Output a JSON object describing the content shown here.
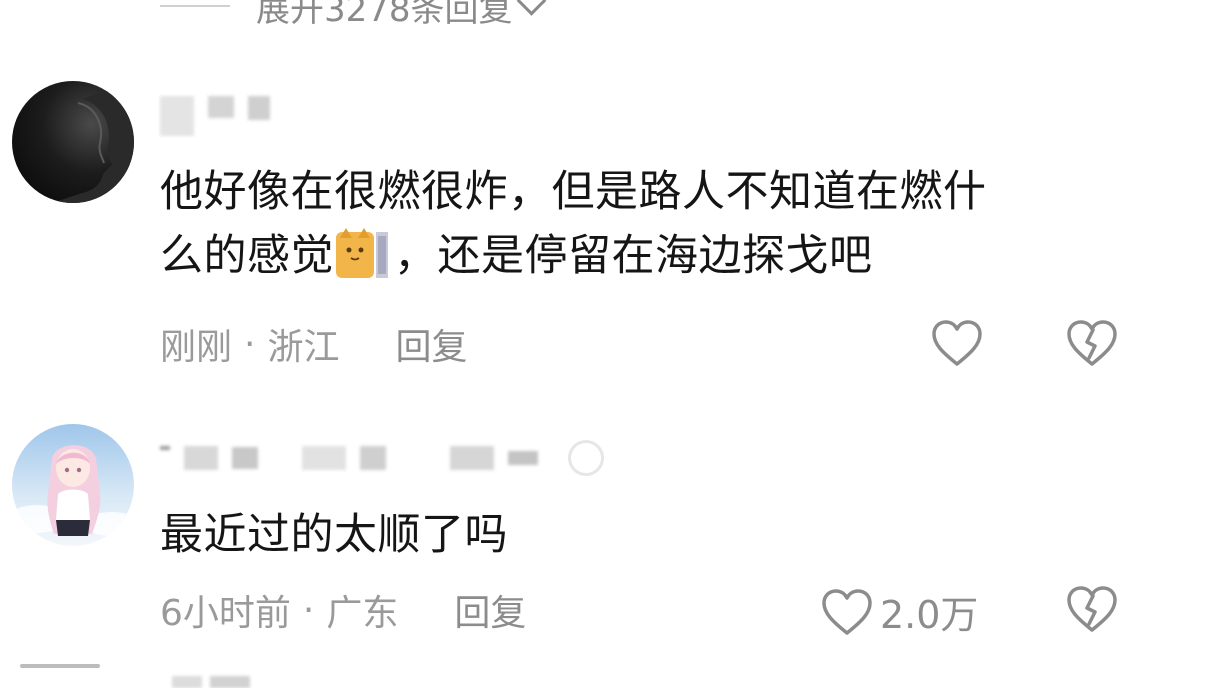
{
  "thread": {
    "expand_replies_label": "展开3278条回复"
  },
  "comments": [
    {
      "text_line1": "他好像在很燃很炸，但是路人不知道在燃什",
      "text_line2_before_emoji": "么的感觉",
      "text_line2_after_emoji": "，还是停留在海边探戈吧",
      "time": "刚刚",
      "separator": "·",
      "location": "浙江",
      "reply_label": "回复",
      "like_count": ""
    },
    {
      "text_line1": "最近过的太顺了吗",
      "time": "6小时前",
      "separator": "·",
      "location": "广东",
      "reply_label": "回复",
      "like_count": "2.0万"
    }
  ],
  "icons": {
    "like": "heart-outline-icon",
    "dislike": "broken-heart-icon",
    "expand": "chevron-down-icon"
  },
  "colors": {
    "meta_text": "#9a9a9a",
    "body_text": "#151515",
    "icon_stroke": "#8c8c8c"
  }
}
